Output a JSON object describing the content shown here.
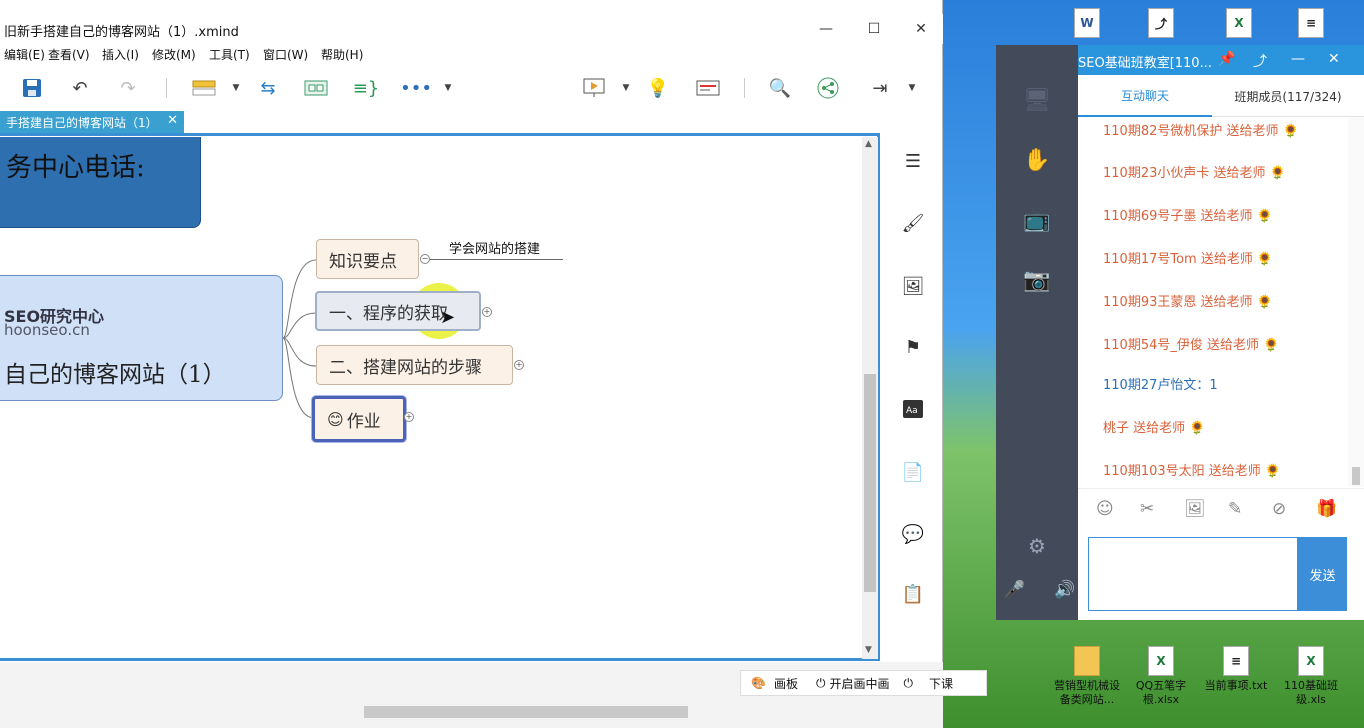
{
  "xmind": {
    "title": "旧新手搭建自己的博客网站（1）.xmind",
    "menu": [
      "编辑(E)",
      "查看(V)",
      "插入(I)",
      "修改(M)",
      "工具(T)",
      "窗口(W)",
      "帮助(H)"
    ],
    "tab_label": "手搭建自己的博客网站（1）",
    "map": {
      "top_box": "务中心电话:",
      "central_seo": "SEO研究中心",
      "central_url": "hoonseo.cn",
      "central_title": "自己的博客网站（1）",
      "branches": [
        "知识要点",
        "一、程序的获取",
        "二、搭建网站的步骤",
        "作业"
      ],
      "sub_topic": "学会网站的搭建"
    }
  },
  "live_controls": {
    "palette": "画板",
    "start_draw": "开启画中画",
    "end_class": "下课"
  },
  "class_panel": {
    "title": "SEO基础班教室[110...",
    "tab_chat": "互动聊天",
    "tab_members": "班期成员(117/324)",
    "messages": [
      {
        "text": "110期82号微机保护 送给老师",
        "type": "gift"
      },
      {
        "text": "110期23小伙声卡 送给老师",
        "type": "gift"
      },
      {
        "text": "110期69号子墨 送给老师",
        "type": "gift"
      },
      {
        "text": "110期17号Tom 送给老师",
        "type": "gift"
      },
      {
        "text": "110期93王蒙恩 送给老师",
        "type": "gift"
      },
      {
        "text": "110期54号_伊俊 送给老师",
        "type": "gift"
      },
      {
        "text": "110期27卢怡文：1",
        "type": "text"
      },
      {
        "text": "桃子 送给老师",
        "type": "gift"
      },
      {
        "text": "110期103号太阳 送给老师",
        "type": "gift"
      }
    ],
    "send_label": "发送"
  },
  "desktop_icons": [
    {
      "label": "营销型机械设备类网站...",
      "kind": "folder"
    },
    {
      "label": "QQ五笔字根.xlsx",
      "kind": "xls"
    },
    {
      "label": "当前事项.txt",
      "kind": "txt"
    },
    {
      "label": "110基础班级.xls",
      "kind": "xls"
    }
  ],
  "colors": {
    "accent": "#2a94dc",
    "tab": "#3aa0d0",
    "gift_text": "#d9623b",
    "chat_text": "#2a6fb8"
  }
}
